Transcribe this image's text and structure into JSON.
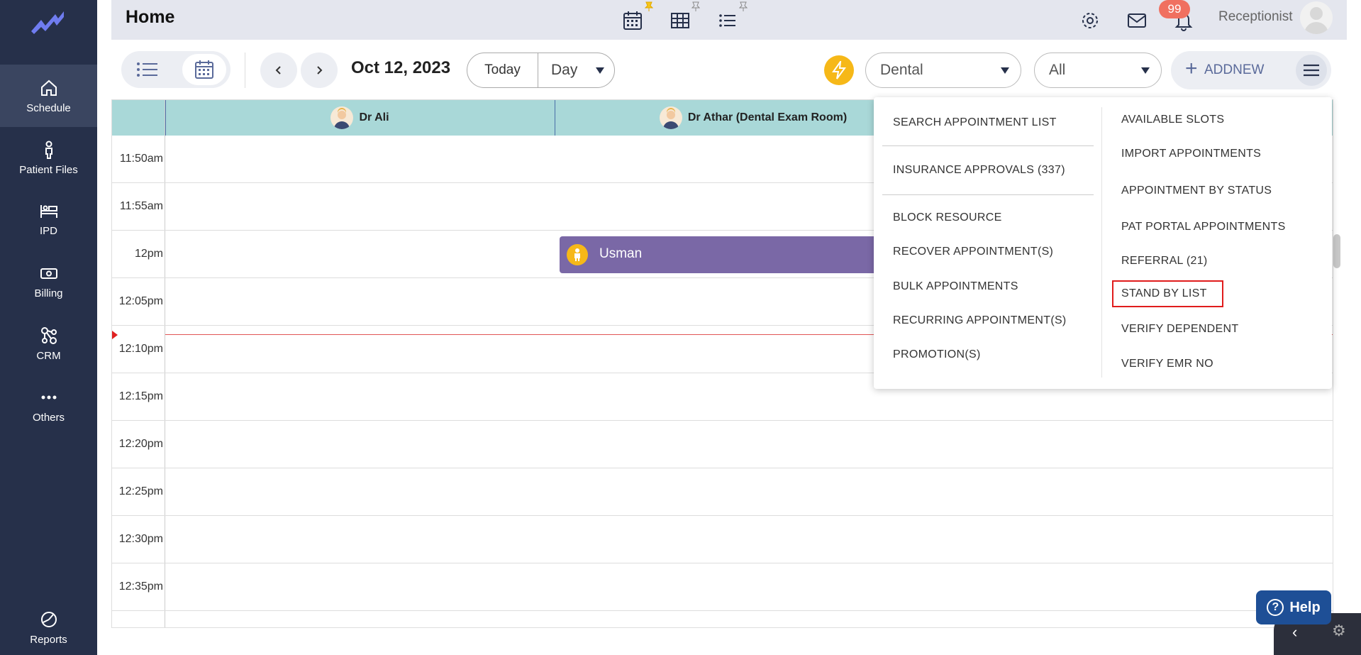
{
  "sidebar": {
    "items": [
      {
        "label": "Schedule",
        "icon": "home-icon",
        "active": true
      },
      {
        "label": "Patient Files",
        "icon": "person-icon"
      },
      {
        "label": "IPD",
        "icon": "bed-icon"
      },
      {
        "label": "Billing",
        "icon": "money-icon"
      },
      {
        "label": "CRM",
        "icon": "network-icon"
      },
      {
        "label": "Others",
        "icon": "more-dots-icon"
      },
      {
        "label": "Reports",
        "icon": "pie-icon"
      }
    ]
  },
  "header": {
    "title": "Home",
    "notification_count": "99",
    "user_role": "Receptionist"
  },
  "toolbar": {
    "date": "Oct 12, 2023",
    "today_label": "Today",
    "view_value": "Day",
    "department_value": "Dental",
    "filter_value": "All",
    "addnew_label": "ADDNEW",
    "accent_color": "#f6b818"
  },
  "calendar": {
    "resources": [
      "Dr Ali",
      "Dr Athar (Dental Exam Room)"
    ],
    "times": [
      "11:50am",
      "11:55am",
      "12pm",
      "12:05pm",
      "12:10pm",
      "12:15pm",
      "12:20pm",
      "12:25pm",
      "12:30pm",
      "12:35pm"
    ],
    "appointment": {
      "patient": "Usman",
      "color": "#7a68a6"
    }
  },
  "menu": {
    "left": [
      "SEARCH APPOINTMENT LIST",
      "INSURANCE APPROVALS (337)",
      "BLOCK RESOURCE",
      "RECOVER APPOINTMENT(S)",
      "BULK APPOINTMENTS",
      "RECURRING APPOINTMENT(S)",
      "PROMOTION(S)"
    ],
    "right": [
      "AVAILABLE SLOTS",
      "IMPORT APPOINTMENTS",
      "APPOINTMENT BY STATUS",
      "PAT PORTAL APPOINTMENTS",
      "REFERRAL (21)",
      "STAND BY LIST",
      "VERIFY DEPENDENT",
      "VERIFY EMR NO"
    ]
  },
  "help": {
    "label": "Help"
  }
}
